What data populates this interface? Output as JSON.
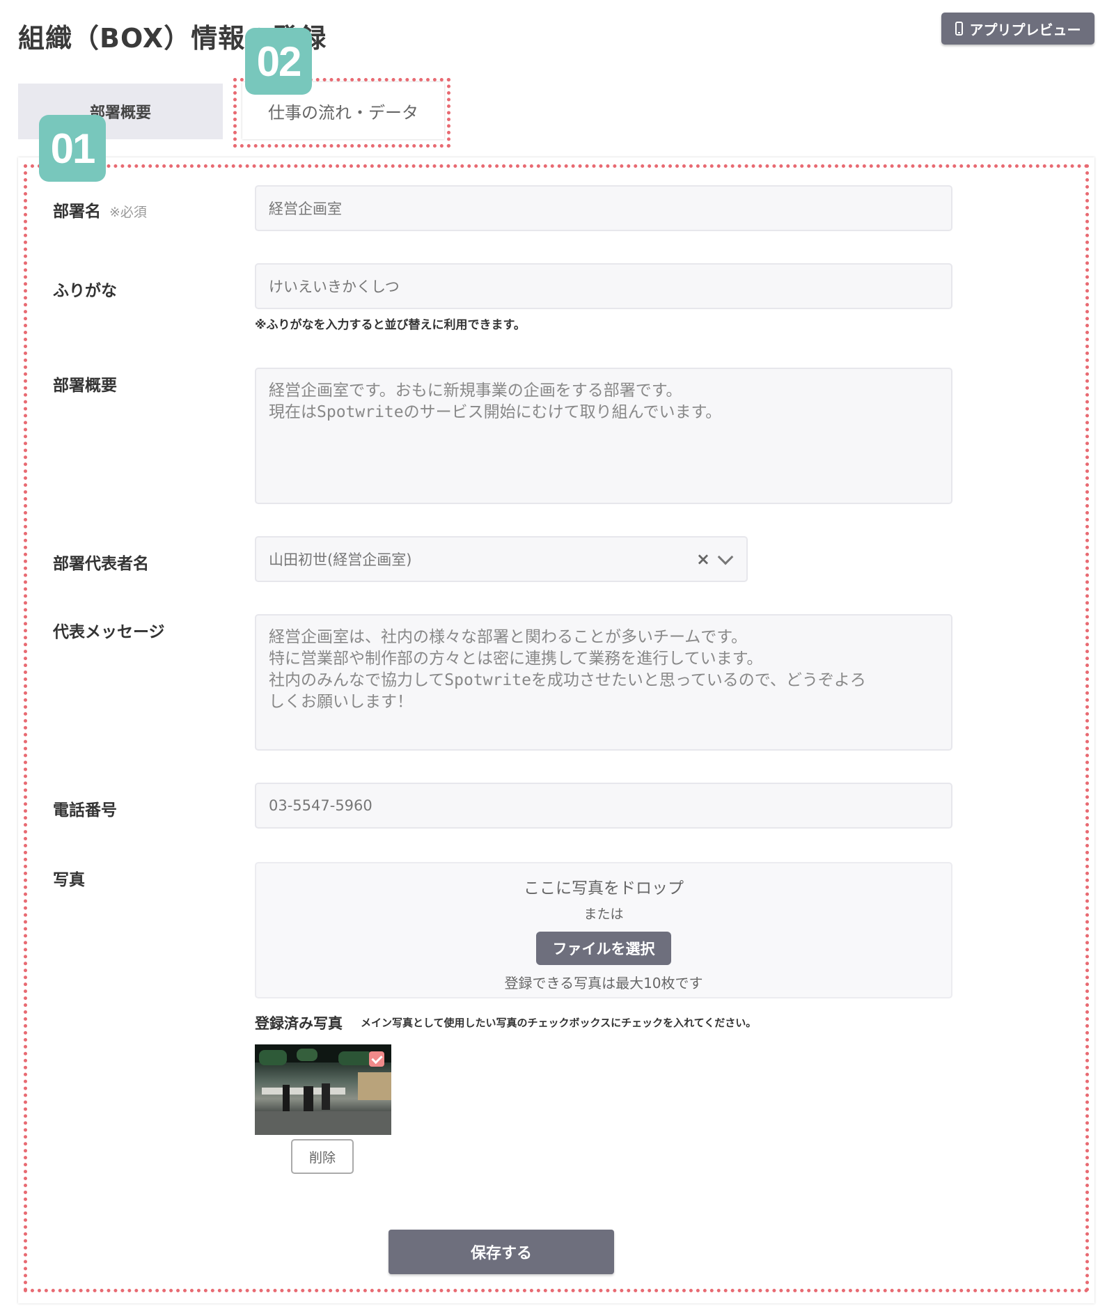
{
  "header": {
    "title": "組織（BOX）情報の登録",
    "preview_button": "アプリプレビュー"
  },
  "tabs": [
    {
      "label": "部署概要",
      "active": true
    },
    {
      "label": "仕事の流れ・データ",
      "active": false
    }
  ],
  "markers": {
    "m1": "01",
    "m2": "02"
  },
  "accent_colors": {
    "marker": "#78c7bc",
    "highlight": "#e86a72",
    "button": "#6e6f7d"
  },
  "form": {
    "dept_name": {
      "label": "部署名",
      "required": "※必須",
      "value": "経営企画室"
    },
    "furigana": {
      "label": "ふりがな",
      "value": "けいえいきかくしつ",
      "note": "※ふりがなを入力すると並び替えに利用できます。"
    },
    "summary": {
      "label": "部署概要",
      "value": "経営企画室です。おもに新規事業の企画をする部署です。\n現在はSpotwriteのサービス開始にむけて取り組んでいます。"
    },
    "representative": {
      "label": "部署代表者名",
      "value": "山田初世(経営企画室)",
      "clear_icon": "×"
    },
    "message": {
      "label": "代表メッセージ",
      "value": "経営企画室は、社内の様々な部署と関わることが多いチームです。\n特に営業部や制作部の方々とは密に連携して業務を進行しています。\n社内のみんなで協力してSpotwriteを成功させたいと思っているので、どうぞよろ\nしくお願いします！"
    },
    "phone": {
      "label": "電話番号",
      "value": "03-5547-5960"
    },
    "photo": {
      "label": "写真",
      "drop_text": "ここに写真をドロップ",
      "or_text": "または",
      "select_button": "ファイルを選択",
      "limit_text": "登録できる写真は最大10枚です",
      "registered_label": "登録済み写真",
      "registered_note": "メイン写真として使用したい写真のチェックボックスにチェックを入れてください。",
      "delete_button": "削除",
      "main_checked": true
    },
    "save_button": "保存する"
  }
}
